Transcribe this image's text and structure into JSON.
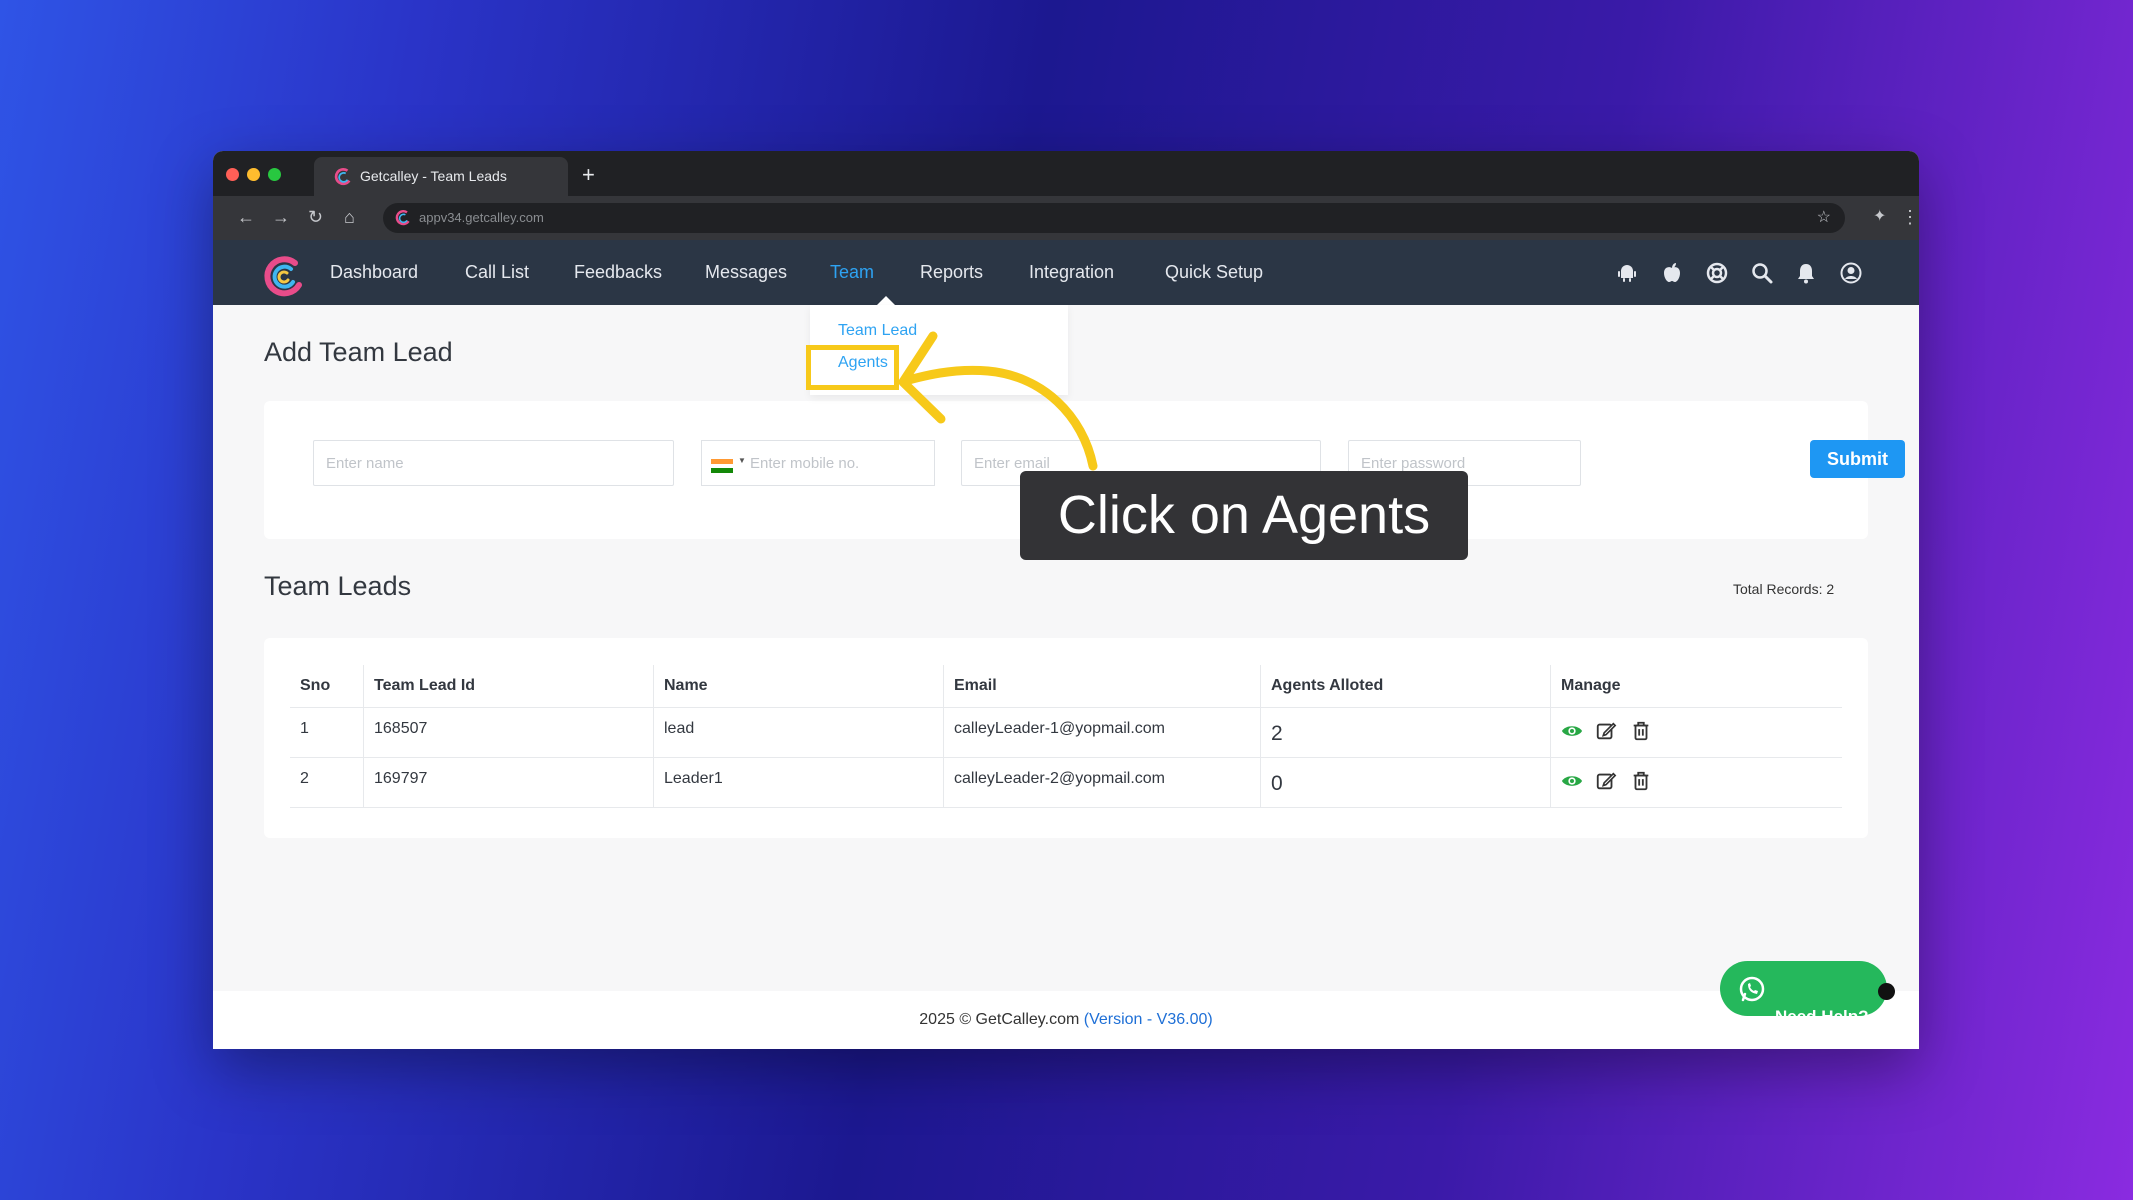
{
  "browser": {
    "tab_title": "Getcalley - Team Leads",
    "new_tab_symbol": "+",
    "url": "appv34.getcalley.com"
  },
  "nav": {
    "items": [
      {
        "label": "Dashboard"
      },
      {
        "label": "Call List"
      },
      {
        "label": "Feedbacks"
      },
      {
        "label": "Messages"
      },
      {
        "label": "Team"
      },
      {
        "label": "Reports"
      },
      {
        "label": "Integration"
      },
      {
        "label": "Quick Setup"
      }
    ],
    "active": "Team",
    "right_icons": [
      "android-icon",
      "apple-icon",
      "support-icon",
      "search-icon",
      "bell-icon",
      "user-icon"
    ]
  },
  "dropdown": {
    "items": [
      {
        "label": "Team Lead"
      },
      {
        "label": "Agents"
      }
    ],
    "highlighted": "Agents"
  },
  "form": {
    "title": "Add Team Lead",
    "name_placeholder": "Enter name",
    "mobile_placeholder": "Enter mobile no.",
    "email_placeholder": "Enter email",
    "password_placeholder": "Enter password",
    "submit_label": "Submit"
  },
  "callout": {
    "text": "Click on Agents"
  },
  "table": {
    "title": "Team Leads",
    "total_records": "Total Records: 2",
    "columns": [
      "Sno",
      "Team Lead Id",
      "Name",
      "Email",
      "Agents Alloted",
      "Manage"
    ],
    "rows": [
      {
        "sno": "1",
        "id": "168507",
        "name": "lead",
        "email": "calleyLeader-1@yopmail.com",
        "agents": "2"
      },
      {
        "sno": "2",
        "id": "169797",
        "name": "Leader1",
        "email": "calleyLeader-2@yopmail.com",
        "agents": "0"
      }
    ]
  },
  "footer": {
    "copyright": "2025 © GetCalley.com",
    "version": "(Version - V36.00)"
  },
  "help_button": {
    "label": "Need Help?"
  },
  "colors": {
    "nav_bg": "#2b3645",
    "accent": "#2ea3f2",
    "submit": "#1e97f3",
    "highlight": "#f7c91a",
    "help": "#25b85c"
  }
}
